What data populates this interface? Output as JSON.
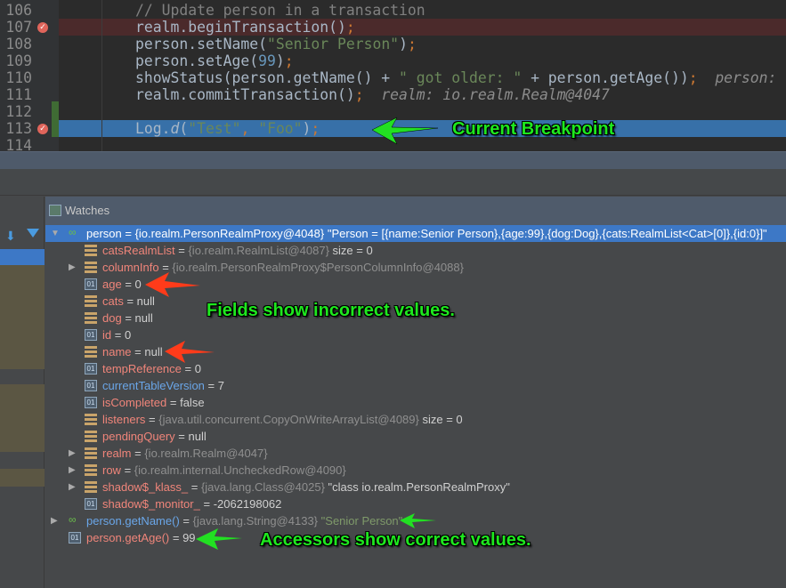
{
  "colors": {
    "code_bg": "#2b2b2b",
    "selection": "#3d78c6",
    "breakpoint_line": "#4b2a2b",
    "current_line": "#3770a8",
    "field_name": "#f0857a",
    "accessor_name": "#6aa6e8",
    "annotation_green": "#1ee81e",
    "annotation_red": "#ff3b1a"
  },
  "editor": {
    "lines": [
      {
        "num": "106",
        "tokens": [
          {
            "t": "// Update person in a transaction",
            "c": "#808080"
          }
        ]
      },
      {
        "num": "107",
        "breakpoint": true,
        "tokens": [
          {
            "t": "realm.beginTransaction()",
            "c": "#a9b7c6"
          },
          {
            "t": ";",
            "c": "#cc7832"
          }
        ]
      },
      {
        "num": "108",
        "tokens": [
          {
            "t": "person.setName(",
            "c": "#a9b7c6"
          },
          {
            "t": "\"Senior Person\"",
            "c": "#6a8759"
          },
          {
            "t": ")",
            "c": "#a9b7c6"
          },
          {
            "t": ";",
            "c": "#cc7832"
          }
        ]
      },
      {
        "num": "109",
        "tokens": [
          {
            "t": "person.setAge(",
            "c": "#a9b7c6"
          },
          {
            "t": "99",
            "c": "#6897bb"
          },
          {
            "t": ")",
            "c": "#a9b7c6"
          },
          {
            "t": ";",
            "c": "#cc7832"
          }
        ]
      },
      {
        "num": "110",
        "tokens": [
          {
            "t": "showStatus(person.getName() + ",
            "c": "#a9b7c6"
          },
          {
            "t": "\" got older: \"",
            "c": "#6a8759"
          },
          {
            "t": " + person.getAge())",
            "c": "#a9b7c6"
          },
          {
            "t": ";",
            "c": "#cc7832"
          },
          {
            "t": "  person: ",
            "c": "#8c8c8c",
            "i": true
          }
        ]
      },
      {
        "num": "111",
        "tokens": [
          {
            "t": "realm.commitTransaction()",
            "c": "#a9b7c6"
          },
          {
            "t": ";",
            "c": "#cc7832"
          },
          {
            "t": "  realm: io.realm.Realm@4047",
            "c": "#8c8c8c",
            "i": true
          }
        ]
      },
      {
        "num": "112",
        "tokens": []
      },
      {
        "num": "113",
        "breakpoint": true,
        "current": true,
        "tokens": [
          {
            "t": "Log.",
            "c": "#a9b7c6"
          },
          {
            "t": "d",
            "c": "#a9b7c6",
            "i": true
          },
          {
            "t": "(",
            "c": "#a9b7c6"
          },
          {
            "t": "\"Test\"",
            "c": "#6a8759"
          },
          {
            "t": ", ",
            "c": "#cc7832"
          },
          {
            "t": "\"Foo\"",
            "c": "#6a8759"
          },
          {
            "t": ")",
            "c": "#a9b7c6"
          },
          {
            "t": ";",
            "c": "#cc7832"
          }
        ]
      },
      {
        "num": "114",
        "tokens": []
      }
    ]
  },
  "watches": {
    "title": "Watches",
    "icon": "watches-icon",
    "rows": [
      {
        "level": 0,
        "expander": "down",
        "icon": "watch",
        "name": "person",
        "nc": "#ffffff",
        "ref": "{io.realm.PersonRealmProxy@4048}",
        "value": "\"Person = [{name:Senior Person},{age:99},{dog:Dog},{cats:RealmList<Cat>[0]},{id:0}]\"",
        "selected": true
      },
      {
        "level": 1,
        "icon": "fld",
        "name": "catsRealmList",
        "nc": "#f0857a",
        "ref": "{io.realm.RealmList@4087}",
        "value": "size = 0"
      },
      {
        "level": 1,
        "expander": "right",
        "icon": "fld",
        "name": "columnInfo",
        "nc": "#f0857a",
        "ref": "{io.realm.PersonRealmProxy$PersonColumnInfo@4088}",
        "value": ""
      },
      {
        "level": 1,
        "icon": "prim",
        "name": "age",
        "nc": "#f0857a",
        "ref": "",
        "value": "0"
      },
      {
        "level": 1,
        "icon": "fld",
        "name": "cats",
        "nc": "#f0857a",
        "ref": "",
        "value": "null"
      },
      {
        "level": 1,
        "icon": "fld",
        "name": "dog",
        "nc": "#f0857a",
        "ref": "",
        "value": "null"
      },
      {
        "level": 1,
        "icon": "prim",
        "name": "id",
        "nc": "#f0857a",
        "ref": "",
        "value": "0"
      },
      {
        "level": 1,
        "icon": "fld",
        "name": "name",
        "nc": "#f0857a",
        "ref": "",
        "value": "null"
      },
      {
        "level": 1,
        "icon": "prim",
        "name": "tempReference",
        "nc": "#f0857a",
        "ref": "",
        "value": "0"
      },
      {
        "level": 1,
        "icon": "prim",
        "name": "currentTableVersion",
        "nc": "#6aa6e8",
        "ref": "",
        "value": "7"
      },
      {
        "level": 1,
        "icon": "prim",
        "name": "isCompleted",
        "nc": "#f0857a",
        "ref": "",
        "value": "false"
      },
      {
        "level": 1,
        "icon": "fld",
        "name": "listeners",
        "nc": "#f0857a",
        "ref": "{java.util.concurrent.CopyOnWriteArrayList@4089}",
        "value": "size = 0"
      },
      {
        "level": 1,
        "icon": "fld",
        "name": "pendingQuery",
        "nc": "#f0857a",
        "ref": "",
        "value": "null"
      },
      {
        "level": 1,
        "expander": "right",
        "icon": "fld",
        "name": "realm",
        "nc": "#f0857a",
        "ref": "{io.realm.Realm@4047}",
        "value": ""
      },
      {
        "level": 1,
        "expander": "right",
        "icon": "fld",
        "name": "row",
        "nc": "#f0857a",
        "ref": "{io.realm.internal.UncheckedRow@4090}",
        "value": ""
      },
      {
        "level": 1,
        "expander": "right",
        "icon": "fld",
        "name": "shadow$_klass_",
        "nc": "#f0857a",
        "ref": "{java.lang.Class@4025}",
        "value": "\"class io.realm.PersonRealmProxy\""
      },
      {
        "level": 1,
        "icon": "prim",
        "name": "shadow$_monitor_",
        "nc": "#f0857a",
        "ref": "",
        "value": "-2062198062"
      },
      {
        "level": 0,
        "expander": "right",
        "icon": "watch",
        "name": "person.getName()",
        "nc": "#6aa6e8",
        "ref": "{java.lang.String@4133}",
        "value": "\"Senior Person\"",
        "vc": "#7f9a6a"
      },
      {
        "level": 0,
        "icon": "prim",
        "name": "person.getAge()",
        "nc": "#f0857a",
        "ref": "",
        "value": "99"
      }
    ]
  },
  "annotations": {
    "breakpoint": "Current Breakpoint",
    "fields": "Fields show incorrect values.",
    "accessors": "Accessors show correct values."
  }
}
